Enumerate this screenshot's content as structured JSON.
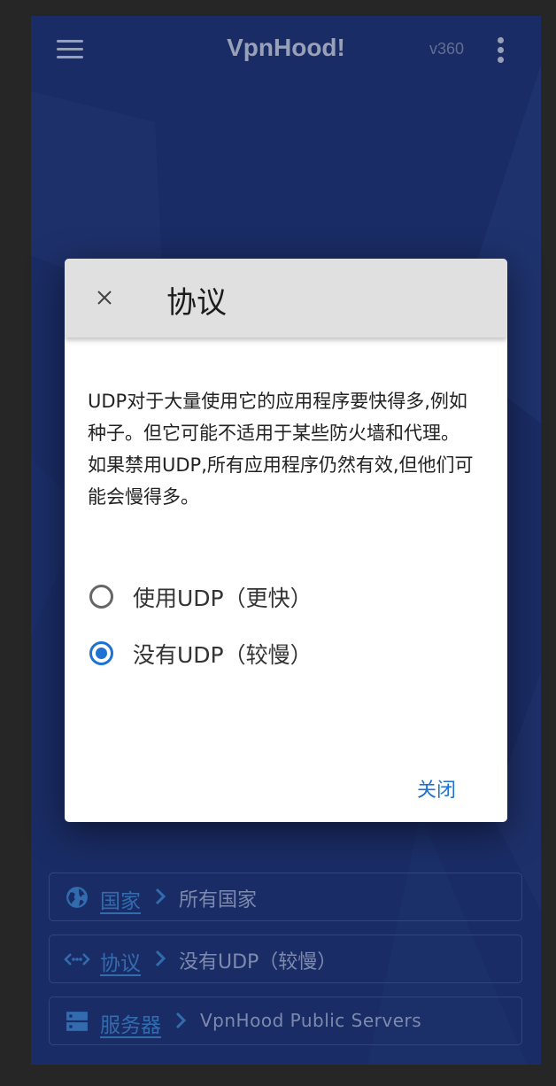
{
  "app": {
    "title": "VpnHood!",
    "version": "v360"
  },
  "dialog": {
    "title": "协议",
    "description": "UDP对于大量使用它的应用程序要快得多,例如种子。但它可能不适用于某些防火墙和代理。如果禁用UDP,所有应用程序仍然有效,但他们可能会慢得多。",
    "options": [
      {
        "label": "使用UDP（更快）",
        "selected": false
      },
      {
        "label": "没有UDP（较慢）",
        "selected": true
      }
    ],
    "close_action": "关闭"
  },
  "bottom": {
    "country": {
      "label": "国家",
      "value": "所有国家",
      "icon": "globe-icon"
    },
    "protocol": {
      "label": "协议",
      "value": "没有UDP（较慢）",
      "icon": "code-arrows-icon"
    },
    "servers": {
      "label": "服务器",
      "value": "VpnHood Public Servers",
      "icon": "server-icon"
    }
  },
  "colors": {
    "background": "#1f3476",
    "accent": "#1d72d2",
    "link": "#3f8ad8"
  }
}
